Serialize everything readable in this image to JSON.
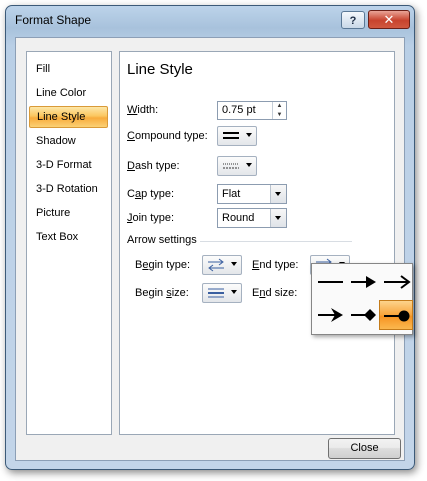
{
  "window": {
    "title": "Format Shape",
    "help_label": "?",
    "close_label": "✕"
  },
  "nav": {
    "items": [
      {
        "label": "Fill"
      },
      {
        "label": "Line Color"
      },
      {
        "label": "Line Style",
        "selected": true
      },
      {
        "label": "Shadow"
      },
      {
        "label": "3-D Format"
      },
      {
        "label": "3-D Rotation"
      },
      {
        "label": "Picture"
      },
      {
        "label": "Text Box"
      }
    ]
  },
  "panel": {
    "title": "Line Style",
    "width": {
      "label_key": "W",
      "label_rest": "idth:",
      "value": "0.75 pt"
    },
    "compound": {
      "label_key": "C",
      "label_rest": "ompound type:",
      "icon": "compound-lines-icon"
    },
    "dash": {
      "label_key": "D",
      "label_rest": "ash type:",
      "icon": "dash-lines-icon"
    },
    "cap": {
      "label_pre": "C",
      "label_key": "a",
      "label_rest": "p type:",
      "value": "Flat"
    },
    "join": {
      "label_key": "J",
      "label_rest": "oin type:",
      "value": "Round"
    },
    "arrow_settings": {
      "heading": "Arrow settings",
      "begin_type": {
        "label_pre": "B",
        "label_key": "e",
        "label_rest": "gin type:",
        "icon": "arrow-type-icon"
      },
      "end_type": {
        "label_key": "E",
        "label_rest": "nd type:",
        "icon": "arrow-type-icon"
      },
      "begin_size": {
        "label_pre": "Begin ",
        "label_key": "s",
        "label_rest": "ize:",
        "icon": "arrow-size-icon"
      },
      "end_size": {
        "label_pre": "E",
        "label_key": "n",
        "label_rest": "d size:"
      }
    }
  },
  "end_type_dropdown": {
    "options": [
      "line-end-none-icon",
      "arrow-end-icon",
      "open-arrow-end-icon",
      "stealth-arrow-end-icon",
      "diamond-arrow-end-icon",
      "oval-arrow-end-icon"
    ],
    "selected": "oval-arrow-end-icon"
  },
  "footer": {
    "close_label": "Close"
  },
  "colors": {
    "selection": "#f8ab3c",
    "title_bar": "#a8c2dc",
    "close_button": "#c8432e"
  }
}
